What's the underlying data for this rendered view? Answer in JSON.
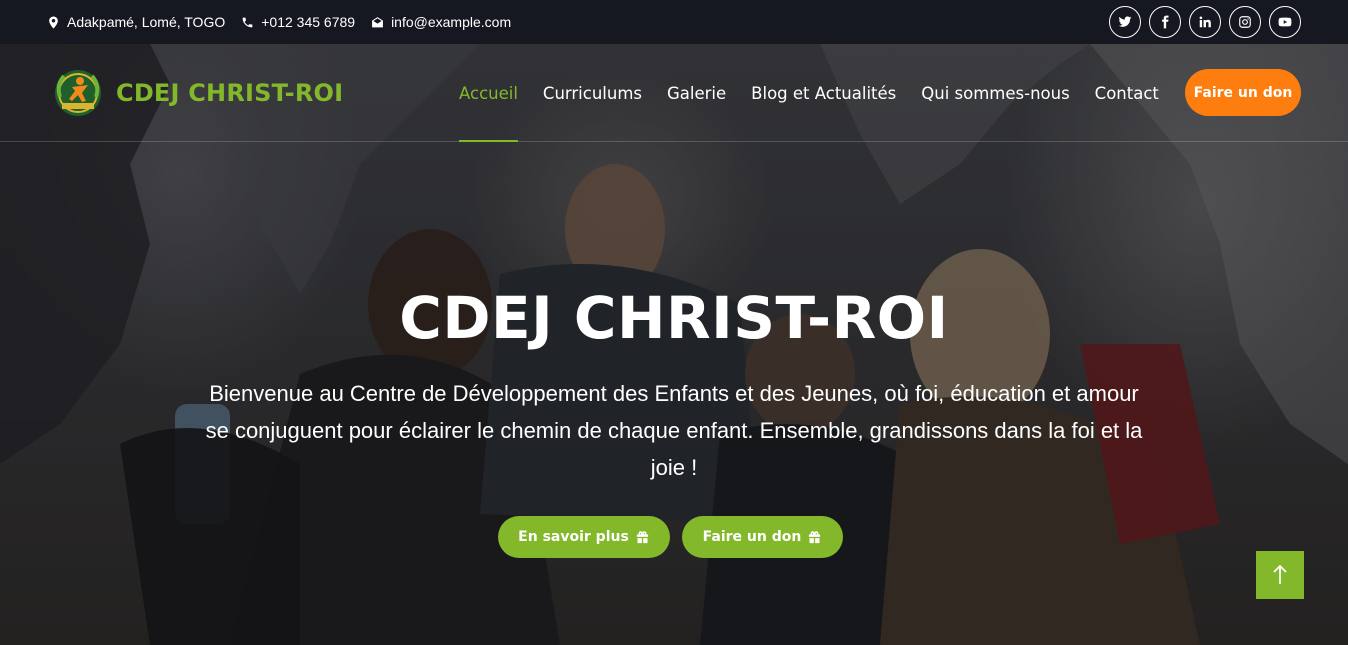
{
  "topbar": {
    "address": "Adakpamé, Lomé, TOGO",
    "phone": "+012 345 6789",
    "email": "info@example.com",
    "socials": [
      {
        "name": "twitter-icon"
      },
      {
        "name": "facebook-icon"
      },
      {
        "name": "linkedin-icon"
      },
      {
        "name": "instagram-icon"
      },
      {
        "name": "youtube-icon"
      }
    ]
  },
  "brand": {
    "name": "CDEJ CHRIST-ROI"
  },
  "nav": {
    "items": [
      {
        "label": "Accueil",
        "active": true
      },
      {
        "label": "Curriculums"
      },
      {
        "label": "Galerie"
      },
      {
        "label": "Blog et Actualités"
      },
      {
        "label": "Qui sommes-nous"
      },
      {
        "label": "Contact"
      }
    ],
    "donate_label": "Faire un don"
  },
  "hero": {
    "title": "CDEJ CHRIST-ROI",
    "text": "Bienvenue au Centre de Développement des Enfants et des Jeunes, où foi, éducation et amour se conjuguent pour éclairer le chemin de chaque enfant. Ensemble, grandissons dans la foi et la joie !",
    "learn_more_label": "En savoir plus",
    "donate_label": "Faire un don"
  },
  "colors": {
    "accent_green": "#83b82b",
    "donate_orange": "#fd7e0e",
    "topbar_bg": "#161821"
  }
}
